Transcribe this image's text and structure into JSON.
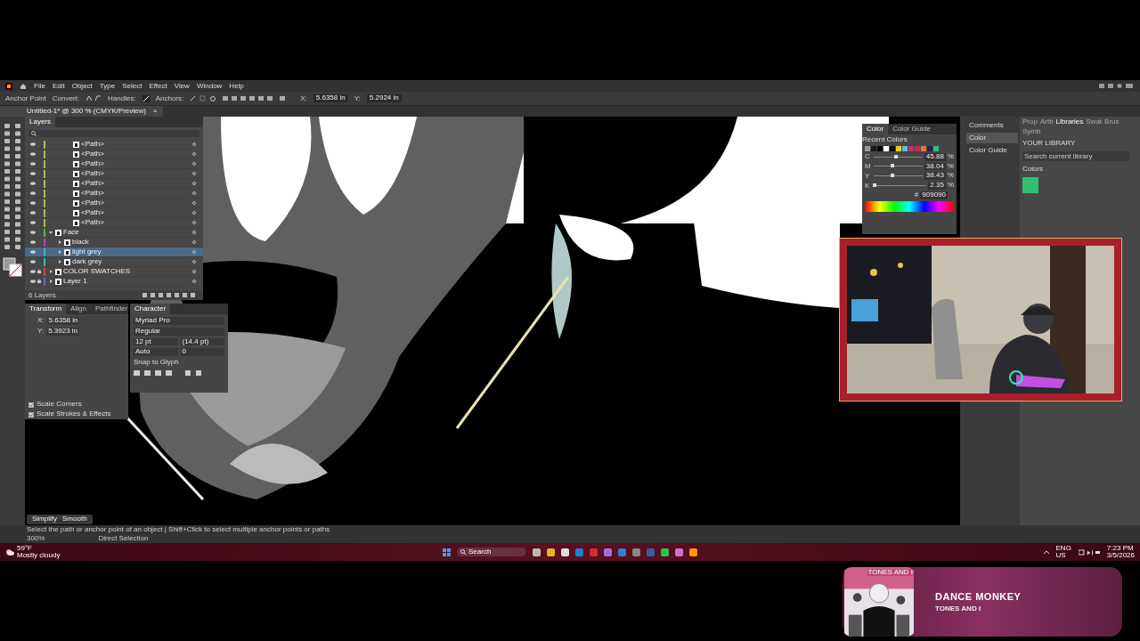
{
  "menu": [
    "File",
    "Edit",
    "Object",
    "Type",
    "Select",
    "Effect",
    "View",
    "Window",
    "Help"
  ],
  "control_bar": {
    "tool": "Anchor Point",
    "convert": "Convert:",
    "handles": "Handles:",
    "anchors": "Anchors:",
    "x_label": "X:",
    "x": "5.6358 in",
    "y_label": "Y:",
    "y": "5.2924 in"
  },
  "document_tab": {
    "title": "Untitled-1* @ 300 % (CMYK/Preview)",
    "close": "×"
  },
  "layers": {
    "tab": "Layers",
    "overflow_paths": [
      {
        "name": "<Path>",
        "color": "#a8b860"
      },
      {
        "name": "<Path>",
        "color": "#a8b860"
      },
      {
        "name": "<Path>",
        "color": "#a8b860"
      },
      {
        "name": "<Path>",
        "color": "#a8b860"
      },
      {
        "name": "<Path>",
        "color": "#a8b860"
      },
      {
        "name": "<Path>",
        "color": "#a8b860"
      },
      {
        "name": "<Path>",
        "color": "#a8b860"
      },
      {
        "name": "<Path>",
        "color": "#a8b860"
      },
      {
        "name": "<Path>",
        "color": "#a8b860"
      }
    ],
    "items": [
      {
        "name": "Face",
        "color": "#5fb04a",
        "selected": false,
        "expanded": true,
        "locked": false,
        "children": [
          {
            "name": "black",
            "color": "#b040c8",
            "selected": false,
            "expanded": false,
            "locked": false
          },
          {
            "name": "light grey",
            "color": "#3fb8b0",
            "selected": true,
            "expanded": false,
            "locked": false
          },
          {
            "name": "dark grey",
            "color": "#3fb8b0",
            "selected": false,
            "expanded": false,
            "locked": false
          }
        ]
      },
      {
        "name": "COLOR SWATCHES",
        "color": "#c04848",
        "selected": false,
        "expanded": false,
        "locked": true
      },
      {
        "name": "Layer 1",
        "color": "#6868c8",
        "selected": false,
        "expanded": false,
        "locked": true
      }
    ],
    "count": "6 Layers"
  },
  "transform": {
    "tabs": [
      {
        "label": "Transform",
        "selected": true
      },
      {
        "label": "Align",
        "selected": false
      },
      {
        "label": "Pathfinder",
        "selected": false
      }
    ],
    "x_label": "X:",
    "x": "5.6358 in",
    "y_label": "Y:",
    "y": "5.3923 in",
    "options": [
      {
        "label": "Scale Corners",
        "checked": true
      },
      {
        "label": "Scale Strokes & Effects",
        "checked": true
      }
    ]
  },
  "character": {
    "tab": "Character",
    "font": "Myriad Pro",
    "style": "Regular",
    "size": "12 pt",
    "leading": "(14.4 pt)",
    "kerning": "Auto",
    "tracking": "0",
    "snap": "Snap to Glyph"
  },
  "color_panel": {
    "tabs": [
      {
        "label": "Color",
        "selected": true
      },
      {
        "label": "Color Guide",
        "selected": false
      }
    ],
    "recent_label": "Recent Colors",
    "recent": [
      {
        "color": "#9a9a9a"
      },
      {
        "color": "#1a1a1a"
      },
      {
        "color": "#000000"
      },
      {
        "color": "#ffffff"
      },
      {
        "color": "#111111"
      },
      {
        "color": "#e8d020"
      },
      {
        "color": "#6ab8d8"
      },
      {
        "color": "#c0306a"
      },
      {
        "color": "#d02848"
      },
      {
        "color": "#e87830"
      },
      {
        "color": "#202060"
      },
      {
        "color": "#30c070"
      }
    ],
    "sliders": [
      {
        "label": "C",
        "level": 0.4588,
        "value": "45.88",
        "unit": "%"
      },
      {
        "label": "M",
        "level": 0.3804,
        "value": "38.04",
        "unit": "%"
      },
      {
        "label": "Y",
        "level": 0.3843,
        "value": "38.43",
        "unit": "%"
      },
      {
        "label": "K",
        "level": 0.0235,
        "value": "2.35",
        "unit": "%"
      }
    ],
    "hex_label": "#",
    "hex": "909090"
  },
  "dock": {
    "items": [
      {
        "label": "Comments",
        "selected": false
      },
      {
        "label": "Color",
        "selected": true
      },
      {
        "label": "Color Guide",
        "selected": false
      }
    ]
  },
  "libraries": {
    "tabs": [
      {
        "label": "Prop",
        "selected": false
      },
      {
        "label": "Artb",
        "selected": false
      },
      {
        "label": "Libraries",
        "selected": true
      },
      {
        "label": "Swat",
        "selected": false
      },
      {
        "label": "Brus",
        "selected": false
      },
      {
        "label": "Symb",
        "selected": false
      }
    ],
    "heading": "YOUR LIBRARY",
    "search_placeholder": "Search current library",
    "section": "Colors",
    "swatches": [
      {
        "color": "#30c070"
      }
    ]
  },
  "bottom_tools": [
    "Simplify",
    "Smooth"
  ],
  "status": {
    "hint": "Select the path or anchor point of an object | Shift+Click to select multiple anchor points or paths",
    "zoom": "300%",
    "tool": "Direct Selection"
  },
  "taskbar": {
    "temperature": "59°F",
    "weather": "Mostly cloudy",
    "search": "Search",
    "language": "ENG",
    "region": "US",
    "time": "7:23 PM",
    "date": "3/5/2026"
  },
  "now_playing": {
    "album_label": "TONES AND I",
    "title": "DANCE MONKEY",
    "artist": "TONES AND I"
  }
}
